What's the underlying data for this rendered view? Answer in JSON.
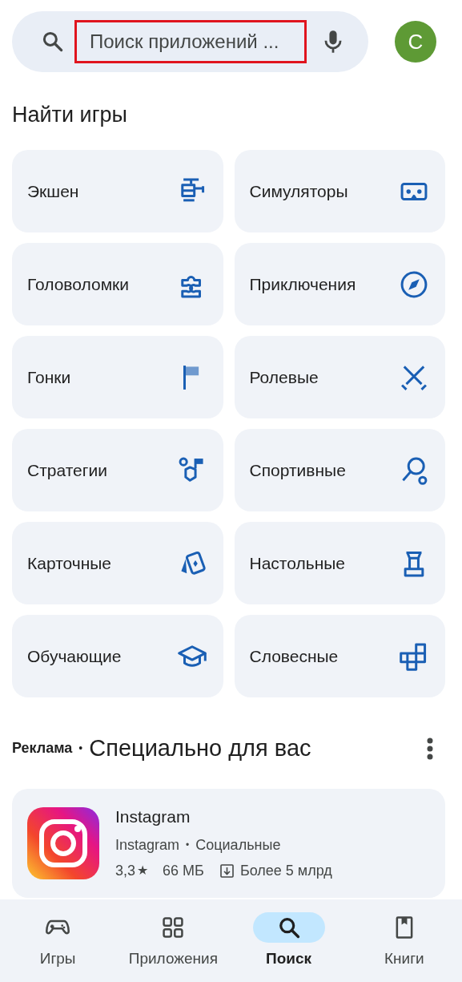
{
  "search": {
    "placeholder": "Поиск приложений ...",
    "highlighted": true
  },
  "account": {
    "initial": "C",
    "color": "#5e9a35"
  },
  "games_section": {
    "title": "Найти игры",
    "categories": [
      {
        "label": "Экшен"
      },
      {
        "label": "Симуляторы"
      },
      {
        "label": "Головоломки"
      },
      {
        "label": "Приключения"
      },
      {
        "label": "Гонки"
      },
      {
        "label": "Ролевые"
      },
      {
        "label": "Стратегии"
      },
      {
        "label": "Спортивные"
      },
      {
        "label": "Карточные"
      },
      {
        "label": "Настольные"
      },
      {
        "label": "Обучающие"
      },
      {
        "label": "Словесные"
      }
    ]
  },
  "ad_section": {
    "badge": "Реклама",
    "separator": "•",
    "title": "Специально для вас",
    "app": {
      "name": "Instagram",
      "developer": "Instagram",
      "separator": "•",
      "category": "Социальные",
      "rating": "3,3",
      "star": "★",
      "size": "66 МБ",
      "downloads": "Более 5 млрд"
    }
  },
  "bottom_nav": [
    {
      "label": "Игры",
      "selected": false
    },
    {
      "label": "Приложения",
      "selected": false
    },
    {
      "label": "Поиск",
      "selected": true
    },
    {
      "label": "Книги",
      "selected": false
    }
  ]
}
